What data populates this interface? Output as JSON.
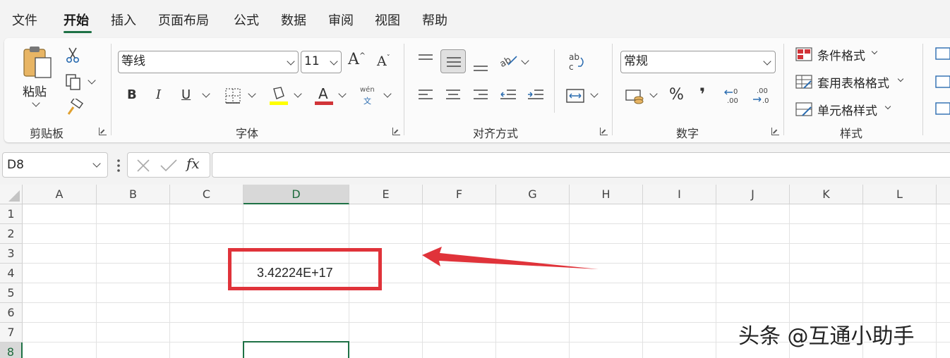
{
  "menu": {
    "tabs": [
      "文件",
      "开始",
      "插入",
      "页面布局",
      "公式",
      "数据",
      "审阅",
      "视图",
      "帮助"
    ],
    "active": "开始"
  },
  "ribbon": {
    "clipboard": {
      "paste_label": "粘贴",
      "group_label": "剪贴板"
    },
    "font": {
      "font_name": "等线",
      "font_size": "11",
      "group_label": "字体",
      "wen_top": "wén",
      "wen_bottom": "文"
    },
    "alignment": {
      "group_label": "对齐方式"
    },
    "number": {
      "format": "常规",
      "percent": "%",
      "comma": "❜",
      "dec_inc": ".00",
      "dec_dec": ".00",
      "group_label": "数字"
    },
    "styles": {
      "conditional": "条件格式",
      "table_format": "套用表格格式",
      "cell_styles": "单元格样式",
      "group_label": "样式"
    }
  },
  "formula_bar": {
    "name_box": "D8",
    "fx": "fx",
    "formula": ""
  },
  "sheet": {
    "columns": [
      "A",
      "B",
      "C",
      "D",
      "E",
      "F",
      "G",
      "H",
      "I",
      "J",
      "K",
      "L"
    ],
    "rows": [
      "1",
      "2",
      "3",
      "4",
      "5",
      "6",
      "7",
      "8"
    ],
    "selected_column": "D",
    "selected_row": "8",
    "cell_D4": "3.42224E+17"
  },
  "annotation": {
    "box_color": "#e0333a",
    "arrow_color": "#e0333a"
  },
  "watermark": "头条 @互通小助手",
  "colors": {
    "accent": "#1e7145",
    "font_red": "#d13438",
    "highlight_yellow": "#ffff00"
  }
}
